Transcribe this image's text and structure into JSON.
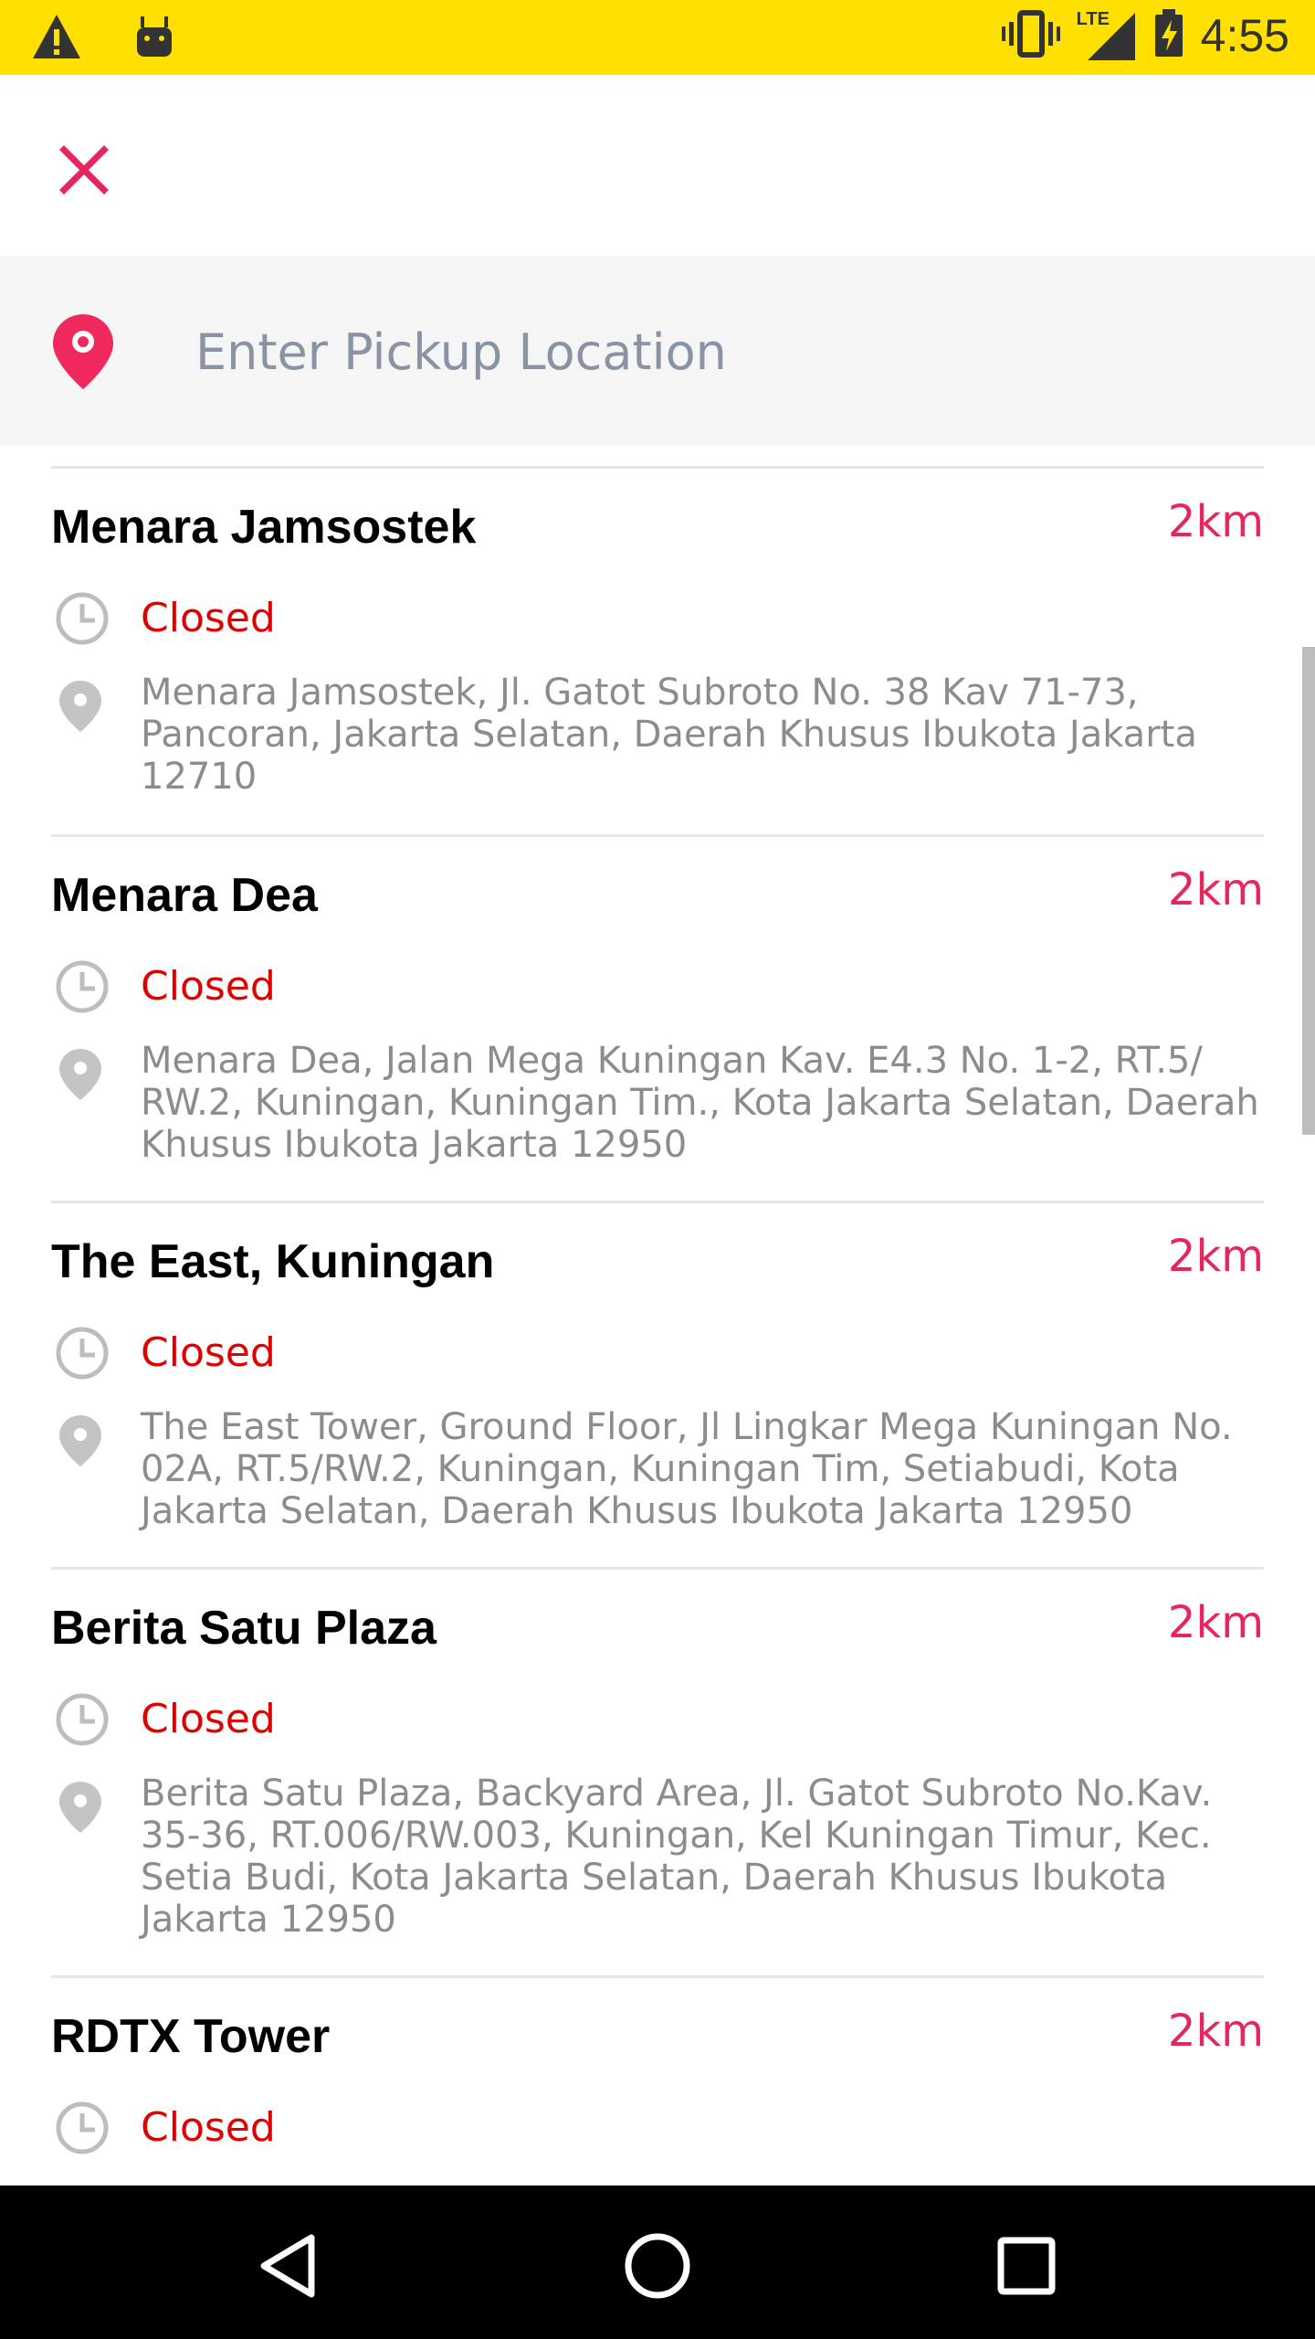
{
  "status_bar": {
    "time": "4:55",
    "network_label": "LTE",
    "background": "#FFE000",
    "left_icons": [
      "warning-icon",
      "android-icon"
    ],
    "right_icons": [
      "vibrate-icon",
      "signal-icon",
      "battery-charging-icon"
    ]
  },
  "header": {
    "close_icon": "close-icon",
    "accent": "#E8265E"
  },
  "search": {
    "placeholder": "Enter Pickup Location",
    "value": ""
  },
  "locations": [
    {
      "name": "Menara Jamsostek",
      "distance": "2km",
      "status": "Closed",
      "address": "Menara Jamsostek, Jl. Gatot Subroto No. 38 Kav 71-73, Pancoran, Jakarta Selatan, Daerah Khusus Ibukota Jakarta 12710"
    },
    {
      "name": "Menara Dea",
      "distance": "2km",
      "status": "Closed",
      "address": "Menara Dea, Jalan Mega Kuningan Kav. E4.3 No. 1-2, RT.5/ RW.2, Kuningan, Kuningan Tim., Kota Jakarta Selatan, Daerah Khusus Ibukota Jakarta 12950"
    },
    {
      "name": "The East, Kuningan",
      "distance": "2km",
      "status": "Closed",
      "address": "The East Tower, Ground Floor, Jl Lingkar Mega Kuningan No. 02A, RT.5/RW.2, Kuningan, Kuningan Tim, Setiabudi, Kota Jakarta Selatan, Daerah Khusus Ibukota Jakarta 12950"
    },
    {
      "name": "Berita Satu Plaza",
      "distance": "2km",
      "status": "Closed",
      "address": "Berita Satu Plaza, Backyard Area, Jl. Gatot Subroto No.Kav. 35-36, RT.006/RW.003, Kuningan, Kel Kuningan Timur, Kec. Setia Budi, Kota Jakarta Selatan, Daerah Khusus Ibukota Jakarta 12950"
    },
    {
      "name": "RDTX Tower",
      "distance": "2km",
      "status": "Closed",
      "address": ""
    }
  ],
  "nav_bar": {
    "icons": [
      "back-icon",
      "home-icon",
      "recents-icon"
    ]
  }
}
